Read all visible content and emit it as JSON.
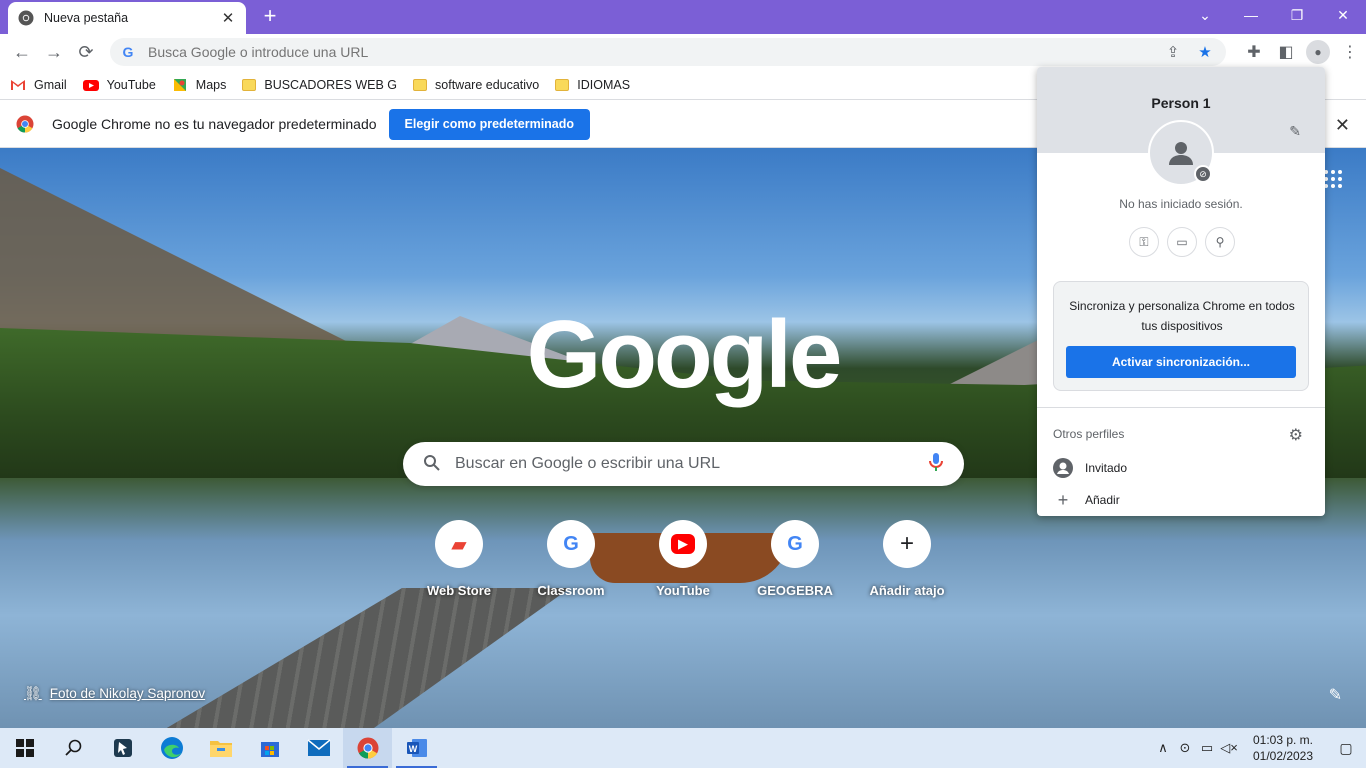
{
  "window": {
    "tab_title": "Nueva pestaña",
    "tab_close": "✕",
    "new_tab": "+",
    "minimize": "—",
    "restore": "❐",
    "close": "✕",
    "tab_search": "⌄"
  },
  "toolbar": {
    "back": "←",
    "forward": "→",
    "reload": "⟳",
    "omnibox_placeholder": "Busca Google o introduce una URL",
    "share": "⇪",
    "bookmark_star": "★",
    "extensions": "✚",
    "side_panel": "◧",
    "profile": "●",
    "menu": "⋮"
  },
  "bookmarks": [
    {
      "label": "Gmail",
      "icon": "gmail-icon"
    },
    {
      "label": "YouTube",
      "icon": "youtube-icon"
    },
    {
      "label": "Maps",
      "icon": "maps-icon"
    },
    {
      "label": "BUSCADORES WEB G",
      "icon": "folder-icon"
    },
    {
      "label": "software educativo",
      "icon": "folder-icon"
    },
    {
      "label": "IDIOMAS",
      "icon": "folder-icon"
    }
  ],
  "infobar": {
    "message": "Google Chrome no es tu navegador predeterminado",
    "button": "Elegir como predeterminado",
    "close": "✕"
  },
  "ntp": {
    "logo": "Google",
    "search_placeholder": "Buscar en Google o escribir una URL",
    "shortcuts": [
      {
        "label": "Web Store",
        "icon": "webstore-icon",
        "glyph": "▰"
      },
      {
        "label": "Classroom",
        "icon": "google-icon",
        "glyph": "G"
      },
      {
        "label": "YouTube",
        "icon": "youtube-icon",
        "glyph": "▶"
      },
      {
        "label": "GEOGEBRA",
        "icon": "google-icon",
        "glyph": "G"
      },
      {
        "label": "Añadir atajo",
        "icon": "add-icon",
        "glyph": "+"
      }
    ],
    "photo_credit": "Foto de Nikolay Sapronov",
    "customize": "✎"
  },
  "profile_popup": {
    "name": "Person 1",
    "edit": "✎",
    "status": "No has iniciado sesión.",
    "sync_text": "Sincroniza y personaliza Chrome en todos tus dispositivos",
    "sync_button": "Activar sincronización...",
    "others_title": "Otros perfiles",
    "guest": "Invitado",
    "add": "Añadir"
  },
  "taskbar": {
    "time": "01:03 p. m.",
    "date": "01/02/2023"
  },
  "colors": {
    "titlebar": "#7b5fd6",
    "accent": "#1a73e8",
    "taskbar": "#dde9f7"
  }
}
